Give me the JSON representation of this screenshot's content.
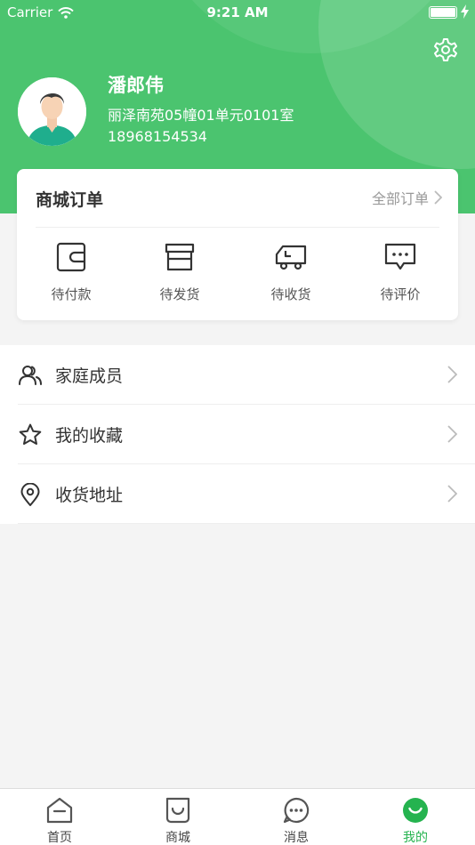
{
  "status_bar": {
    "carrier": "Carrier",
    "time": "9:21 AM"
  },
  "profile": {
    "name": "潘郎伟",
    "address": "丽泽南苑05幢01单元0101室",
    "phone": "18968154534"
  },
  "orders": {
    "title": "商城订单",
    "all_label": "全部订单",
    "items": [
      {
        "label": "待付款",
        "icon": "wallet-icon"
      },
      {
        "label": "待发货",
        "icon": "box-icon"
      },
      {
        "label": "待收货",
        "icon": "truck-icon"
      },
      {
        "label": "待评价",
        "icon": "comment-icon"
      }
    ]
  },
  "menu": [
    {
      "label": "家庭成员",
      "icon": "family-icon"
    },
    {
      "label": "我的收藏",
      "icon": "star-icon"
    },
    {
      "label": "收货地址",
      "icon": "location-icon"
    }
  ],
  "tabbar": [
    {
      "label": "首页",
      "icon": "home-icon",
      "active": false
    },
    {
      "label": "商城",
      "icon": "bag-icon",
      "active": false
    },
    {
      "label": "消息",
      "icon": "message-icon",
      "active": false
    },
    {
      "label": "我的",
      "icon": "smile-icon",
      "active": true
    }
  ],
  "colors": {
    "primary": "#4bc46f",
    "active_tab": "#25b34f"
  }
}
